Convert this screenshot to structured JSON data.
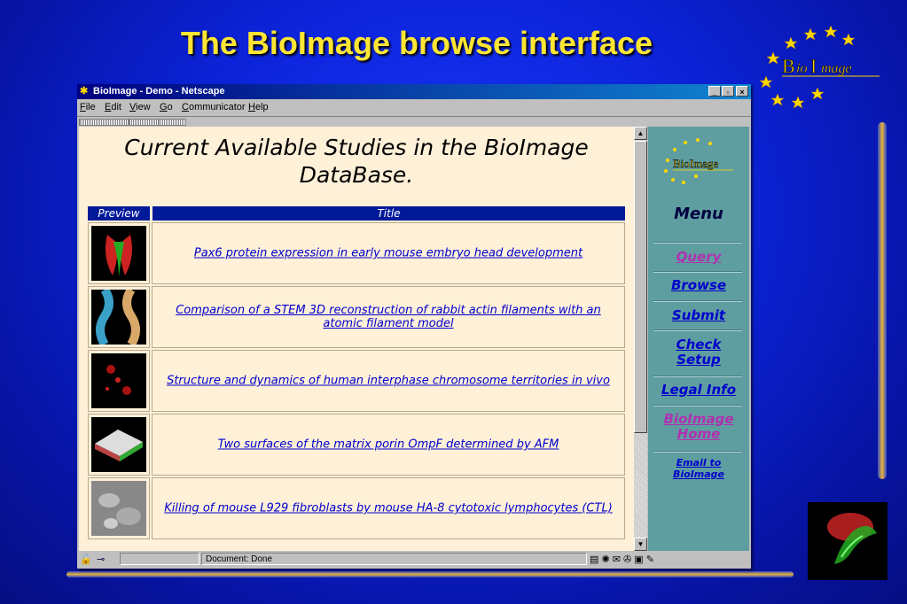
{
  "slide": {
    "title": "The BioImage browse interface",
    "logo_text": "BioImage"
  },
  "window": {
    "title": "BioImage - Demo - Netscape",
    "controls": [
      "_",
      "▫",
      "×"
    ],
    "menus": [
      "File",
      "Edit",
      "View",
      "Go",
      "Communicator",
      "Help"
    ]
  },
  "page": {
    "heading": "Current Available Studies in the BioImage DataBase.",
    "columns": [
      "Preview",
      "Title"
    ],
    "studies": [
      {
        "title": "Pax6 protein expression in early mouse embryo head development"
      },
      {
        "title": "Comparison of a STEM 3D reconstruction of rabbit actin filaments with an atomic filament model"
      },
      {
        "title": "Structure and dynamics of human interphase chromosome territories in vivo"
      },
      {
        "title": "Two surfaces of the matrix porin OmpF determined by AFM"
      },
      {
        "title": "Killing of mouse L929 fibroblasts by mouse HA-8 cytotoxic lymphocytes (CTL)"
      }
    ]
  },
  "menu": {
    "title": "Menu",
    "items": [
      {
        "label": "Query",
        "color": "#b030b0"
      },
      {
        "label": "Browse",
        "color": "#0000cc"
      },
      {
        "label": "Submit",
        "color": "#0000cc"
      },
      {
        "label": "Check Setup",
        "color": "#0000cc"
      },
      {
        "label": "Legal Info",
        "color": "#0000cc"
      },
      {
        "label": "BioImage Home",
        "color": "#b030b0"
      },
      {
        "label": "Email to BioImage",
        "color": "#0000cc"
      }
    ]
  },
  "status": {
    "text": "Document: Done"
  },
  "colors": {
    "background": "#0b22d6",
    "title": "#ffe633",
    "table_header": "#001a9a",
    "content_bg": "#fff0d8",
    "menu_bg": "#5f9ea0"
  }
}
